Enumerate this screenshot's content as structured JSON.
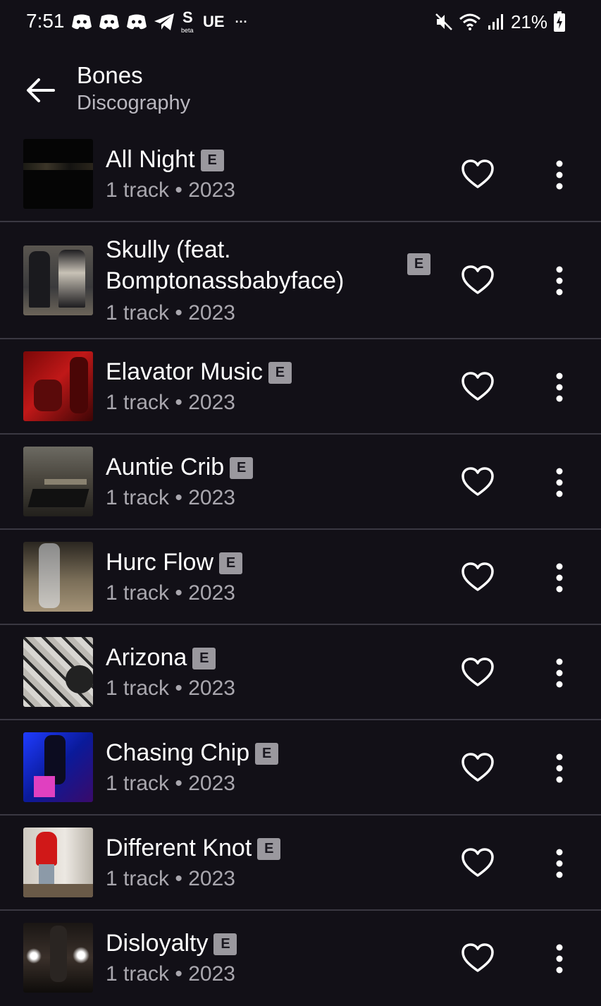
{
  "status_bar": {
    "time": "7:51",
    "carrier_text": "UE",
    "beta_text": "beta",
    "battery": "21%"
  },
  "header": {
    "title": "Bones",
    "subtitle": "Discography"
  },
  "explicit_badge": "E",
  "albums": [
    {
      "title": "All Night",
      "meta": "1 track • 2023"
    },
    {
      "title": "Skully (feat. Bomptonassbabyface)",
      "meta": "1 track • 2023"
    },
    {
      "title": "Elavator Music",
      "meta": "1 track • 2023"
    },
    {
      "title": "Auntie Crib",
      "meta": "1 track • 2023"
    },
    {
      "title": "Hurc Flow",
      "meta": "1 track • 2023"
    },
    {
      "title": "Arizona",
      "meta": "1 track • 2023"
    },
    {
      "title": "Chasing Chip",
      "meta": "1 track • 2023"
    },
    {
      "title": "Different Knot",
      "meta": "1 track • 2023"
    },
    {
      "title": "Disloyalty",
      "meta": "1 track • 2023"
    }
  ],
  "colors": {
    "background": "#121017",
    "divider": "#3a3842",
    "subtitle_text": "#a9a7ae",
    "badge_bg": "#9a989e"
  },
  "icons": [
    "back-arrow-icon",
    "heart-outline-icon",
    "more-vertical-icon",
    "discord-icon",
    "telegram-icon",
    "mute-icon",
    "wifi-icon",
    "signal-icon",
    "battery-icon"
  ]
}
